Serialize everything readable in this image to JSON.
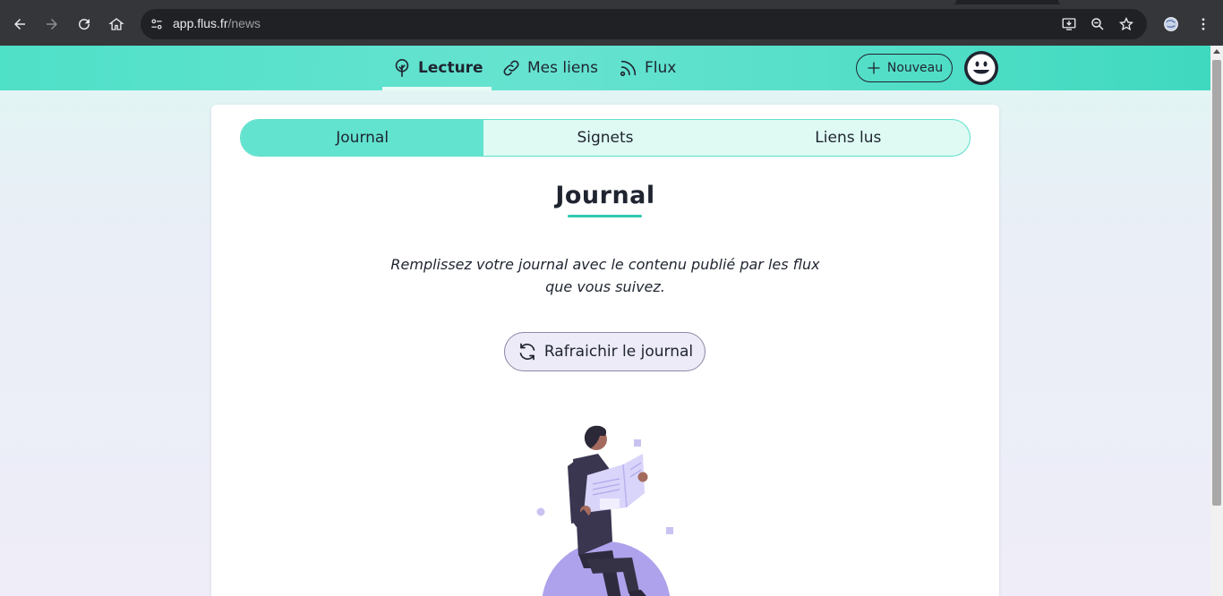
{
  "browser": {
    "url_host": "app.flus.fr",
    "url_path": "/news"
  },
  "header": {
    "nav": [
      {
        "label": "Lecture",
        "active": true
      },
      {
        "label": "Mes liens",
        "active": false
      },
      {
        "label": "Flux",
        "active": false
      }
    ],
    "new_button": "Nouveau"
  },
  "tabs": [
    {
      "label": "Journal",
      "active": true
    },
    {
      "label": "Signets",
      "active": false
    },
    {
      "label": "Liens lus",
      "active": false
    }
  ],
  "main": {
    "title": "Journal",
    "intro": "Remplissez votre journal avec le contenu publié par les flux que vous suivez.",
    "refresh_button": "Rafraichir le journal"
  },
  "colors": {
    "accent": "#62e3cf",
    "accent_dark": "#2cc9ad",
    "text": "#1f2430",
    "illustration_purple": "#aea2ec"
  }
}
